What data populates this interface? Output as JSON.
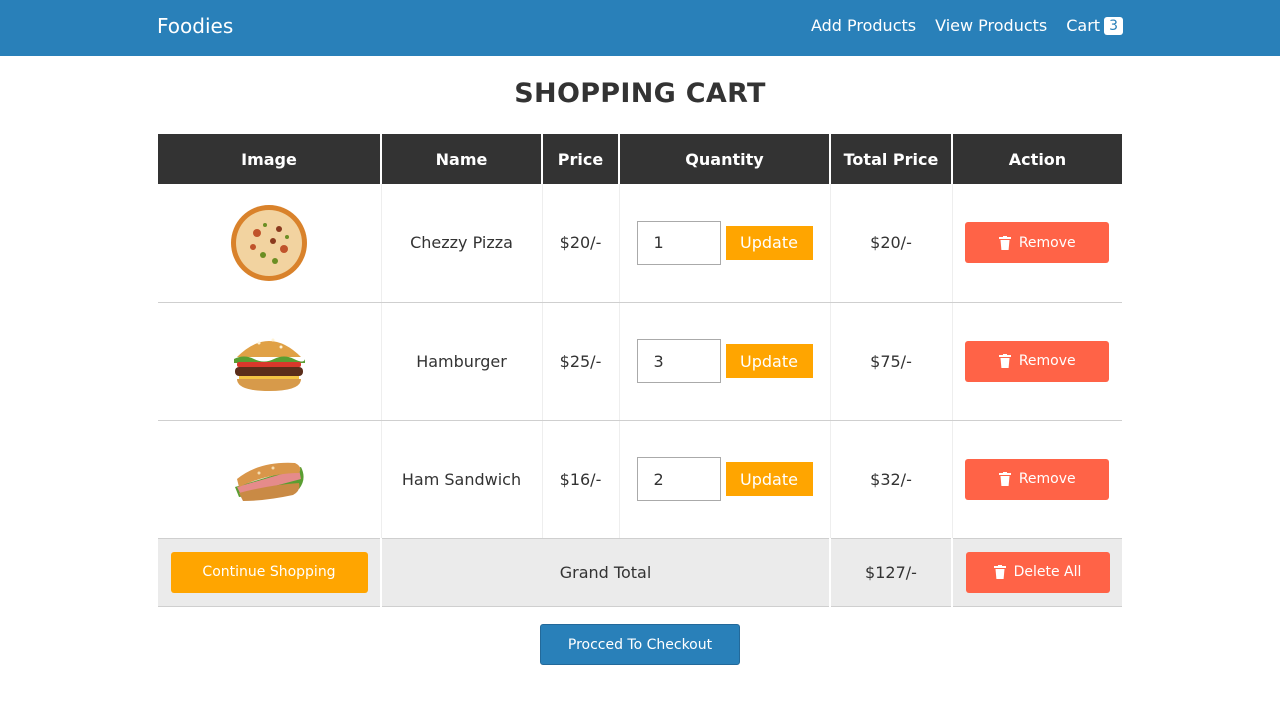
{
  "navbar": {
    "brand": "Foodies",
    "links": [
      "Add Products",
      "View Products"
    ],
    "cart_label": "Cart",
    "cart_count": "3"
  },
  "title": "SHOPPING CART",
  "table": {
    "headers": [
      "Image",
      "Name",
      "Price",
      "Quantity",
      "Total Price",
      "Action"
    ],
    "rows": [
      {
        "image": "pizza-image",
        "name": "Chezzy Pizza",
        "price": "$20/-",
        "quantity": "1",
        "update_label": "Update",
        "total": "$20/-",
        "remove_label": "Remove"
      },
      {
        "image": "hamburger-image",
        "name": "Hamburger",
        "price": "$25/-",
        "quantity": "3",
        "update_label": "Update",
        "total": "$75/-",
        "remove_label": "Remove"
      },
      {
        "image": "sandwich-image",
        "name": "Ham Sandwich",
        "price": "$16/-",
        "quantity": "2",
        "update_label": "Update",
        "total": "$32/-",
        "remove_label": "Remove"
      }
    ],
    "footer": {
      "continue_label": "Continue Shopping",
      "grand_total_label": "Grand Total",
      "grand_total": "$127/-",
      "delete_all_label": "Delete All"
    }
  },
  "checkout_label": "Procced To Checkout",
  "colors": {
    "navbar": "#2980b9",
    "header": "#333333",
    "update": "#ffa500",
    "remove": "#ff6347",
    "checkout": "#2980b9"
  }
}
